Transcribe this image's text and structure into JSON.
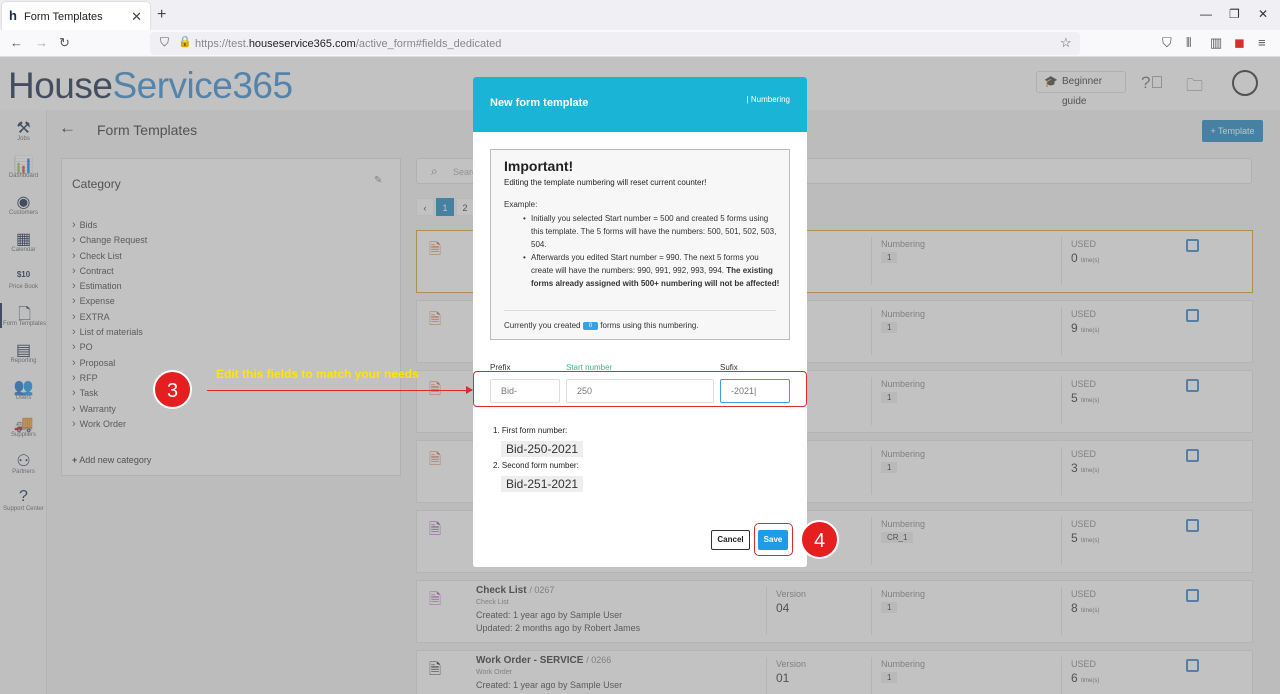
{
  "browser": {
    "tab_title": "Form Templates",
    "url_prefix": "https://test.",
    "url_domain": "houseservice365.com",
    "url_path": "/active_form#fields_dedicated"
  },
  "app": {
    "logo_a": "House",
    "logo_b": "Service365",
    "beginner_guide": "Beginner guide",
    "page_title": "Form Templates",
    "template_button": "+ Template",
    "search_placeholder": "Search",
    "pages": [
      "‹",
      "1",
      "2"
    ]
  },
  "sidebar": [
    {
      "icon": "tools-icon",
      "glyph": "⚒",
      "label": "Jobs"
    },
    {
      "icon": "chart-icon",
      "glyph": "📊",
      "label": "Dashboard"
    },
    {
      "icon": "customers-icon",
      "glyph": "◉",
      "label": "Customers"
    },
    {
      "icon": "calendar-icon",
      "glyph": "▦",
      "label": "Calendar"
    },
    {
      "icon": "pricebook-icon",
      "glyph": "$10",
      "label": "Price Book"
    },
    {
      "icon": "form-icon",
      "glyph": "🗋",
      "label": "Form Templates"
    },
    {
      "icon": "report-icon",
      "glyph": "▤",
      "label": "Reporting"
    },
    {
      "icon": "users-icon",
      "glyph": "👥",
      "label": "Users"
    },
    {
      "icon": "truck-icon",
      "glyph": "🚚",
      "label": "Suppliers"
    },
    {
      "icon": "partners-icon",
      "glyph": "⚇",
      "label": "Partners"
    },
    {
      "icon": "support-icon",
      "glyph": "?",
      "label": "Support Center"
    }
  ],
  "category": {
    "title": "Category",
    "items": [
      "Bids",
      "Change Request",
      "Check List",
      "Contract",
      "Estimation",
      "Expense",
      "EXTRA",
      "List of materials",
      "PO",
      "Proposal",
      "RFP",
      "Task",
      "Warranty",
      "Work Order"
    ],
    "add_new": "Add new category"
  },
  "rows": [
    {
      "name": "",
      "code": "",
      "sub": "",
      "created": "",
      "updated": "",
      "version_label": "",
      "version": "",
      "numbering_label": "Numbering",
      "numbering": "1",
      "used_label": "USED",
      "used": "0",
      "used_unit": "time(s)",
      "color": "#e0632d"
    },
    {
      "name": "",
      "code": "",
      "sub": "",
      "created": "",
      "updated": "",
      "version_label": "",
      "version": "",
      "numbering_label": "Numbering",
      "numbering": "1",
      "used_label": "USED",
      "used": "9",
      "used_unit": "time(s)",
      "color": "#e0632d"
    },
    {
      "name": "",
      "code": "",
      "sub": "",
      "created": "",
      "updated": "",
      "version_label": "",
      "version": "",
      "numbering_label": "Numbering",
      "numbering": "1",
      "used_label": "USED",
      "used": "5",
      "used_unit": "time(s)",
      "color": "#e0632d"
    },
    {
      "name": "",
      "code": "",
      "sub": "",
      "created": "",
      "updated": "",
      "version_label": "",
      "version": "",
      "numbering_label": "Numbering",
      "numbering": "1",
      "used_label": "USED",
      "used": "3",
      "used_unit": "time(s)",
      "color": "#e0632d"
    },
    {
      "name": "",
      "code": "",
      "sub": "",
      "created": "",
      "updated": "",
      "version_label": "",
      "version": "",
      "numbering_label": "Numbering",
      "numbering": "CR_1",
      "used_label": "USED",
      "used": "5",
      "used_unit": "time(s)",
      "color": "#8e3da8"
    },
    {
      "name": "Check List",
      "code": "/ 0267",
      "sub": "Check List",
      "created": "Created: 1 year ago by Sample User",
      "updated": "Updated: 2 months ago by Robert James",
      "version_label": "Version",
      "version": "04",
      "numbering_label": "Numbering",
      "numbering": "1",
      "used_label": "USED",
      "used": "8",
      "used_unit": "time(s)",
      "color": "#b54fc4"
    },
    {
      "name": "Work Order - SERVICE",
      "code": "/ 0266",
      "sub": "Work Order",
      "created": "Created: 1 year ago by Sample User",
      "updated": "",
      "version_label": "Version",
      "version": "01",
      "numbering_label": "Numbering",
      "numbering": "1",
      "used_label": "USED",
      "used": "6",
      "used_unit": "time(s)",
      "color": "#222222"
    }
  ],
  "modal": {
    "title": "New form template",
    "tab": "| Numbering",
    "important_title": "Important!",
    "important_sub": "Editing the template numbering will reset current counter!",
    "example_label": "Example:",
    "bullet1": "Initially you selected Start number = 500 and created 5 forms using this template. The 5 forms will have the numbers: 500, 501, 502, 503, 504.",
    "bullet2_a": "Afterwards you edited Start number = 990. The next 5 forms you create will have the numbers: 990, 991, 992, 993, 994.",
    "bullet2_b": "The existing forms already assigned with 500+ numbering will not be affected!",
    "count_a": "Currently you created",
    "count_badge": "0",
    "count_b": "forms using this numbering.",
    "prefix_label": "Prefix",
    "prefix_value": "Bid-",
    "start_label": "Start number",
    "start_value": "250",
    "sufix_label": "Sufix",
    "sufix_value": "-2021|",
    "first_label": "1. First form number:",
    "first_value": "Bid-250-2021",
    "second_label": "2. Second form number:",
    "second_value": "Bid-251-2021",
    "cancel": "Cancel",
    "save": "Save"
  },
  "annotations": {
    "step3": "3",
    "step3_text": "Edit this fields to match your needs",
    "step4": "4"
  },
  "colors": {
    "modal_header": "#1ab5d6",
    "primary": "#1e88c7",
    "annotation_red": "#e51f1f",
    "annotation_text": "#ffe600"
  }
}
